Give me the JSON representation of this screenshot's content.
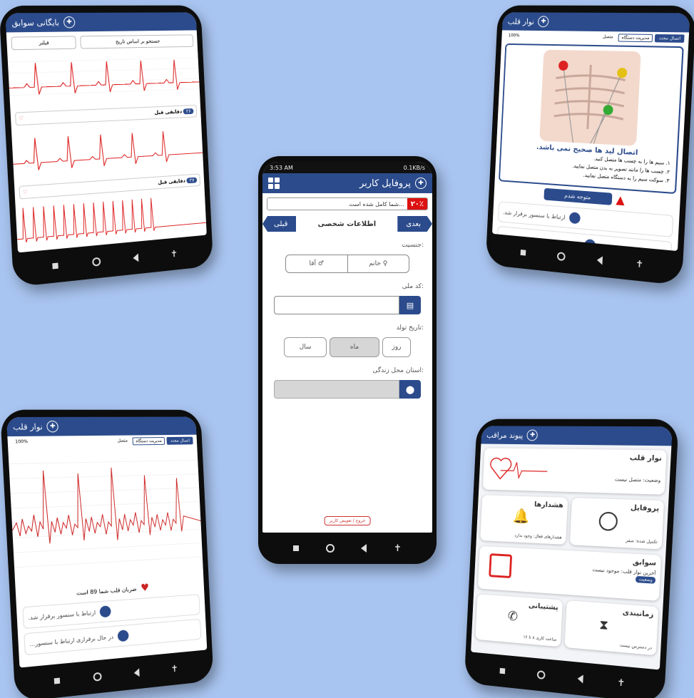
{
  "center": {
    "status_time": "3:53 AM",
    "status_right": "0.1KB/s",
    "title": "پروفایل کاربر",
    "alert_pct": "۲۰٪",
    "alert_text": "شما کامل شده است...",
    "next_label": "بعدی",
    "prev_label": "قبلی",
    "step_title": "اطلاعات شخصی",
    "gender_label": "جنسیت:",
    "female": "♀ خانم",
    "male": "♂ آقا",
    "national_code_label": "کد ملی:",
    "national_code_value": "",
    "birth_label": "تاریخ تولد:",
    "day": "روز",
    "month": "ماه",
    "year": "سال",
    "province_label": "استان محل زندگی:",
    "province_value": "",
    "logout": "خروج / تعویض کاربر"
  },
  "top_left": {
    "title": "بایگانی سوابق",
    "filter": "فیلتر",
    "search": "جستجو بر اساس تاریخ",
    "rec1_title": "دقایقی قبل",
    "rec1_badge": "۲۶",
    "rec2_title": "دقایقی قبل",
    "rec2_badge": "۲۷"
  },
  "top_right": {
    "title": "نوار قلب",
    "tab1": "اتصال مجدد",
    "tab2": "مدیریت دستگاه",
    "tab3": "متصل",
    "battery": "100%",
    "warning_title": "اتصال لید ها صحیح نمی باشد.",
    "warn1": "۱. سیم ها را به چسب ها متصل کنید.",
    "warn2": "۲. چسب ها را مانند تصویر به بدن متصل نمایید.",
    "warn3": "۳. سوکت سیم را به دستگاه متصل نمایید.",
    "ok_button": "متوجه شدم",
    "row1": "ارتباط با سنسور برقرار شد.",
    "row2": "در حال برقراری ارتباط با سنسور..."
  },
  "bottom_left": {
    "title": "نوار قلب",
    "tab1": "اتصال مجدد",
    "tab2": "مدیریت دستگاه",
    "tab3": "متصل",
    "battery": "100%",
    "heart_rate": "ضربان قلب شما 89 است",
    "row1": "ارتباط با سنسور برقرار شد.",
    "row2": "در حال برقراری ارتباط با سنسور..."
  },
  "bottom_right": {
    "title": "پیوند مراقب",
    "ecg_title": "نوار قلب",
    "ecg_status": "وضعیت: متصل نیست",
    "profile": "پروفایل",
    "profile_sub": "تکمیل شده: صفر",
    "alerts": "هشدارها",
    "alerts_sub": "هشدارهای فعال: وجود ندارد",
    "history": "سوابق",
    "history_sub": "آخرین نوار قلب: موجود نیست",
    "history_status": "وضعیت",
    "schedule": "زمانبندی",
    "schedule_sub": "در دسترس نیست",
    "support": "پشتیبانی",
    "support_sub": "ساعت کاری ۸ تا ۱۶"
  },
  "colors": {
    "primary": "#2b4b8c",
    "alert": "#d11111",
    "bg": "#a8c4f0"
  }
}
